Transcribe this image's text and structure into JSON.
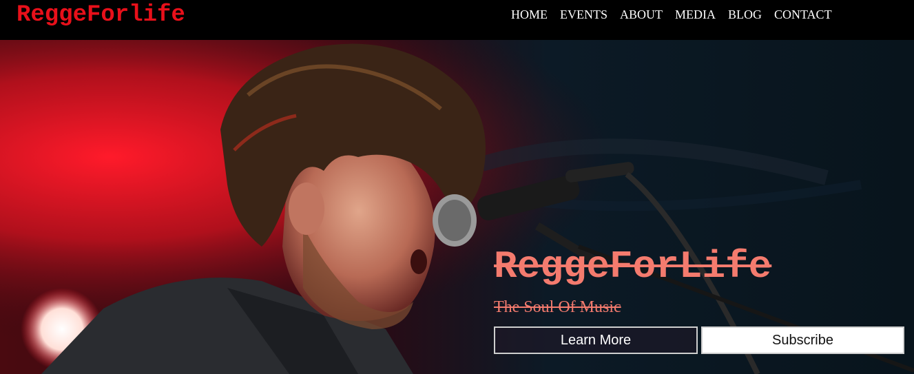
{
  "header": {
    "logo_text": "ReggeForlife",
    "nav_items": [
      {
        "label": "HOME"
      },
      {
        "label": "EVENTS"
      },
      {
        "label": "ABOUT"
      },
      {
        "label": "MEDIA"
      },
      {
        "label": "BLOG"
      },
      {
        "label": "CONTACT"
      }
    ]
  },
  "hero": {
    "image_subject": "singer-at-microphone-photo",
    "title": "ReggeForLife",
    "subtitle": "The Soul Of Music",
    "learn_more_label": "Learn More",
    "subscribe_label": "Subscribe"
  },
  "colors": {
    "logo": "#e8101a",
    "hero_text": "#f47b6e",
    "nav_background": "#000000",
    "nav_text": "#ffffff"
  }
}
